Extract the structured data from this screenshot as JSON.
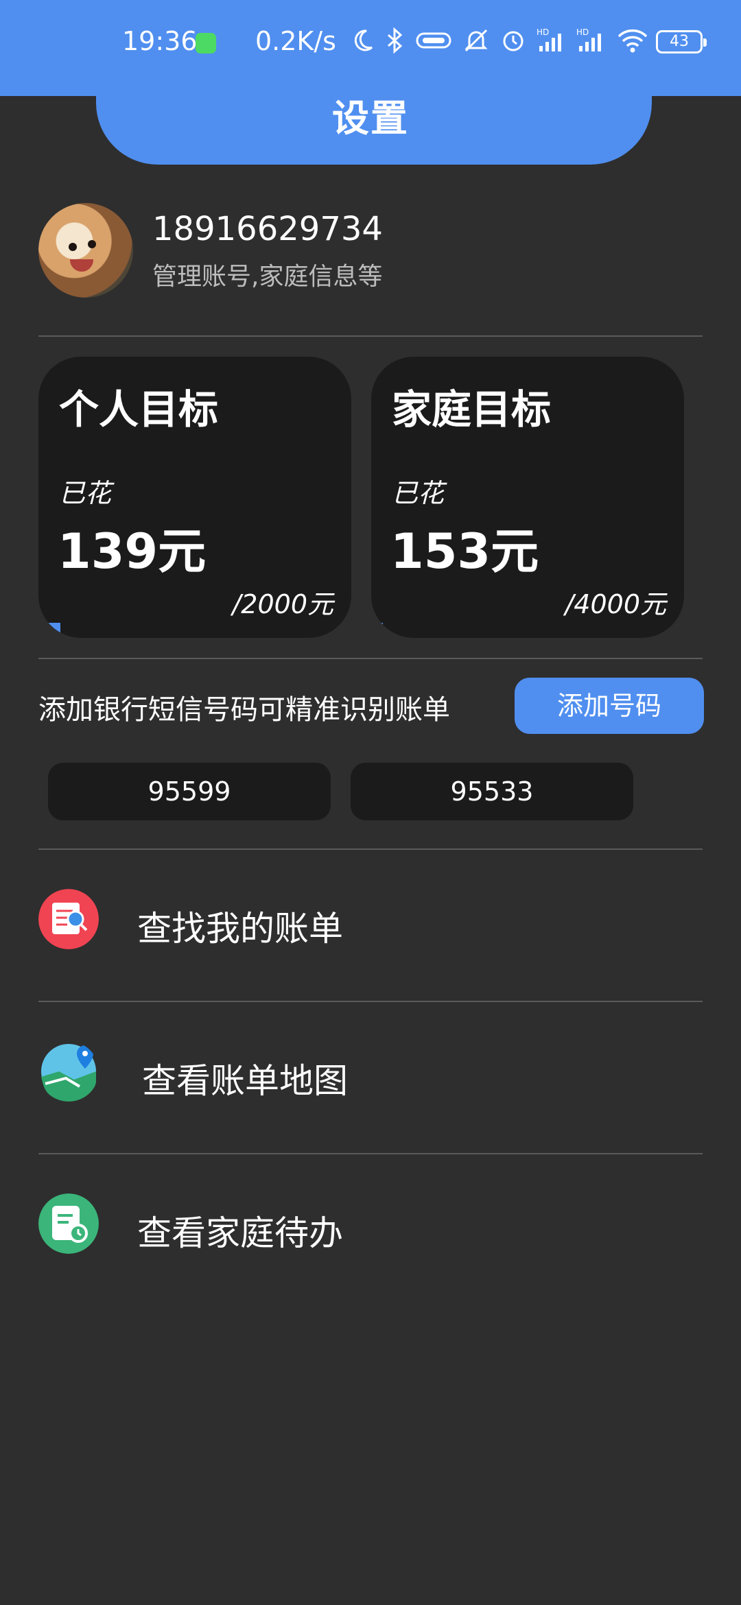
{
  "status_bar": {
    "time": "19:36",
    "net_speed": "0.2K/s",
    "battery": "43",
    "icons": [
      "app-notification-icon",
      "moon-icon",
      "bluetooth-icon",
      "vibrate-icon",
      "mute-icon",
      "alarm-icon",
      "signal-hd-icon",
      "signal-hd-icon",
      "wifi-icon",
      "battery-icon"
    ]
  },
  "header": {
    "title": "设置"
  },
  "profile": {
    "phone": "18916629734",
    "subtitle": "管理账号,家庭信息等"
  },
  "goals": [
    {
      "title": "个人目标",
      "spent_label": "已花",
      "amount": "139元",
      "total": "/2000元",
      "progress": 0.0695
    },
    {
      "title": "家庭目标",
      "spent_label": "已花",
      "amount": "153元",
      "total": "/4000元",
      "progress": 0.03825
    }
  ],
  "sms": {
    "hint": "添加银行短信号码可精准识别账单",
    "add_button": "添加号码",
    "numbers": [
      "95599",
      "95533"
    ]
  },
  "menu": [
    {
      "label": "查找我的账单",
      "icon": "bill-search-icon",
      "color": "#f04452"
    },
    {
      "label": "查看账单地图",
      "icon": "bill-map-icon",
      "color": "#3fa9e0"
    },
    {
      "label": "查看家庭待办",
      "icon": "family-todo-icon",
      "color": "#3bb57a"
    }
  ],
  "colors": {
    "accent": "#508ff0",
    "background": "#2e2e2e",
    "card": "#1b1b1b"
  }
}
